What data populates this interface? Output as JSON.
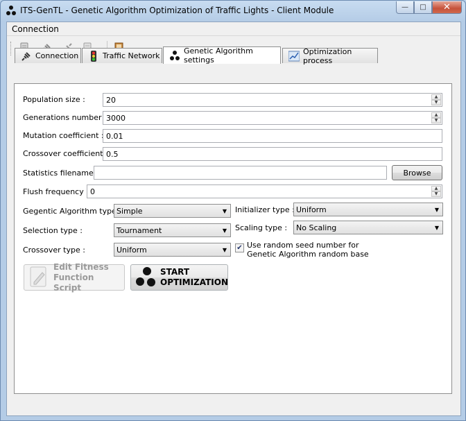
{
  "window": {
    "title": "ITS-GenTL - Genetic Algorithm Optimization of Traffic Lights - Client Module",
    "minimize": "—",
    "maximize": "□",
    "close": "✕"
  },
  "menu": {
    "connection": "Connection"
  },
  "toolbar": {
    "icons": [
      "add-server-icon",
      "connect-plug-icon",
      "disconnect-plug-icon",
      "server-icon",
      "exit-door-icon"
    ]
  },
  "tabs": [
    {
      "label": "Connection",
      "icon": "plug-icon"
    },
    {
      "label": "Traffic Network",
      "icon": "traffic-light-icon"
    },
    {
      "label": "Genetic Algorithm settings",
      "icon": "ga-molecule-icon",
      "active": true
    },
    {
      "label": "Optimization process",
      "icon": "chart-icon"
    }
  ],
  "form": {
    "population_label": "Population size :",
    "population_value": "20",
    "generations_label": "Generations number :",
    "generations_value": "3000",
    "mutation_label": "Mutation coefficient :",
    "mutation_value": "0.01",
    "crossover_coef_label": "Crossover coefficient :",
    "crossover_coef_value": "0.5",
    "stats_label": "Statistics filename :",
    "stats_value": "",
    "browse_label": "Browse",
    "flush_label": "Flush frequency :",
    "flush_value": "0",
    "ga_type_label": "Gegentic Algorithm type :",
    "ga_type_value": "Simple",
    "initializer_label": "Initializer type :",
    "initializer_value": "Uniform",
    "selection_label": "Selection type :",
    "selection_value": "Tournament",
    "scaling_label": "Scaling type :",
    "scaling_value": "No Scaling",
    "crossover_type_label": "Crossover type :",
    "crossover_type_value": "Uniform",
    "random_seed_line1": "Use random seed number for",
    "random_seed_line2": "Genetic Algorithm random base",
    "random_seed_checked": true
  },
  "actions": {
    "edit_fitness_line1": "Edit Fitness",
    "edit_fitness_line2": "Function Script",
    "start_line1": "START",
    "start_line2": "OPTIMIZATION"
  },
  "colors": {
    "title_bar": "#b9d1ea",
    "close_button": "#c6523a",
    "panel": "#ffffff"
  }
}
